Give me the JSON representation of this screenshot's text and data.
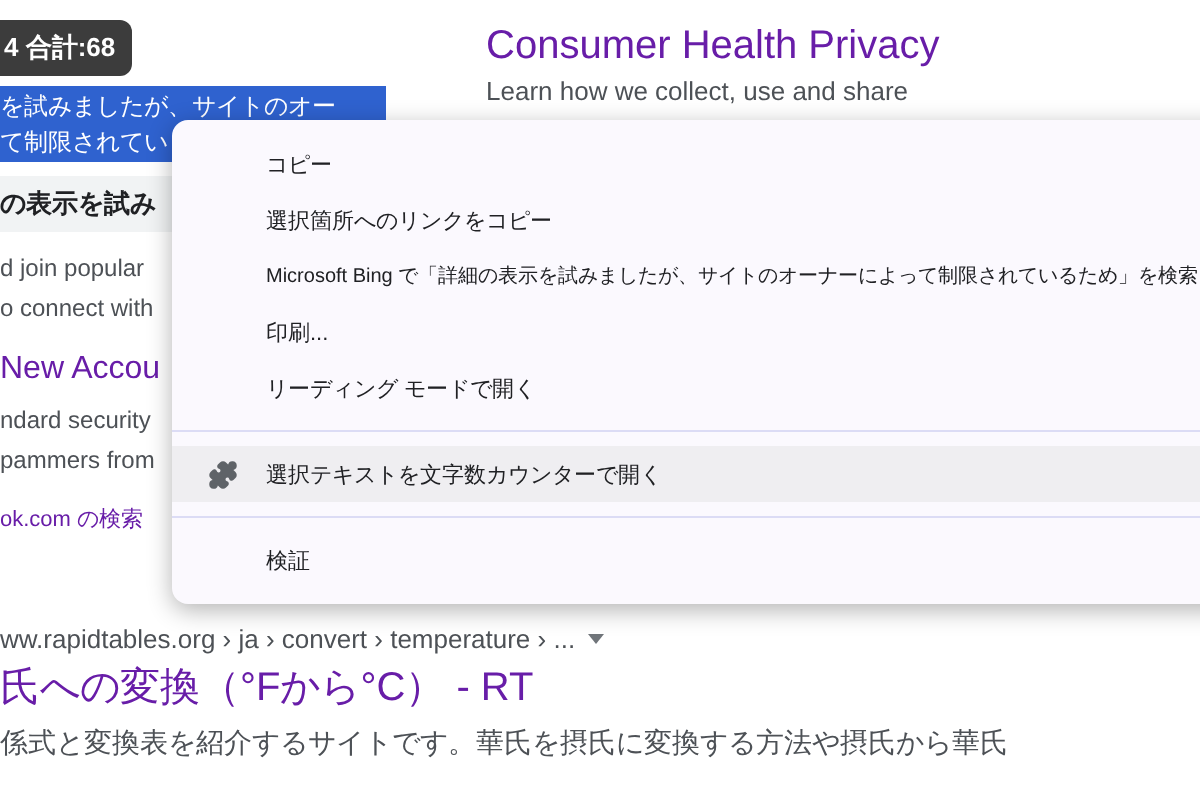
{
  "badge": "4 合計:68",
  "selection": {
    "lines": [
      "を試みましたが、サイトのオー",
      "て制限されてい"
    ]
  },
  "left_column": {
    "heading": "の表示を試み",
    "snippet": [
      "d join popular",
      "o connect with"
    ],
    "result_title": "New Accou",
    "result_snippet": [
      "ndard security",
      "pammers from"
    ],
    "link": "ok.com の検索"
  },
  "right_column": {
    "title": "Consumer Health Privacy",
    "snippet": "Learn how we collect, use and share"
  },
  "result": {
    "breadcrumb": "ww.rapidtables.org › ja › convert › temperature › ...",
    "title": "氏への変換（°Fから°C） - RT",
    "snippet": "係式と変換表を紹介するサイトです。華氏を摂氏に変換する方法や摂氏から華氏"
  },
  "context_menu": {
    "items": [
      {
        "kind": "item",
        "label": "コピー",
        "highlighted": false
      },
      {
        "kind": "item",
        "label": "選択箇所へのリンクをコピー",
        "highlighted": false
      },
      {
        "kind": "item",
        "label": "Microsoft Bing で「詳細の表示を試みましたが、サイトのオーナーによって制限されているため」を検索",
        "highlighted": false
      },
      {
        "kind": "item",
        "label": "印刷...",
        "highlighted": false
      },
      {
        "kind": "item",
        "label": "リーディング モードで開く",
        "highlighted": false
      },
      {
        "kind": "separator"
      },
      {
        "kind": "extension",
        "label": "選択テキストを文字数カウンターで開く",
        "highlighted": true
      },
      {
        "kind": "separator"
      },
      {
        "kind": "item",
        "label": "検証",
        "highlighted": false
      }
    ]
  }
}
